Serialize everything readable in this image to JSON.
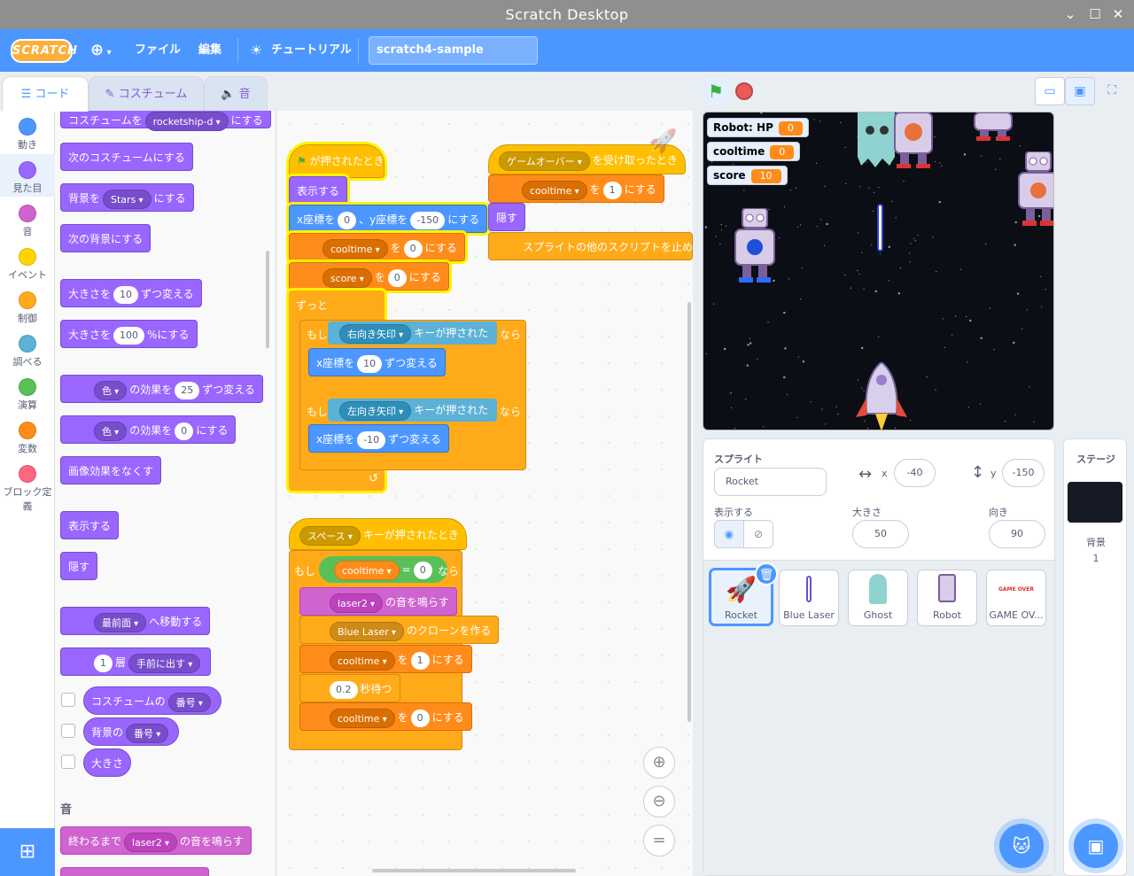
{
  "window": {
    "title": "Scratch Desktop"
  },
  "menu": {
    "logo": "SCRATCH",
    "file": "ファイル",
    "edit": "編集",
    "tutorial": "チュートリアル",
    "project_title": "scratch4-sample"
  },
  "tabs": {
    "code": "コード",
    "costume": "コスチューム",
    "sound": "音"
  },
  "categories": [
    {
      "label": "動き",
      "color": "#4c97ff"
    },
    {
      "label": "見た目",
      "color": "#9966ff"
    },
    {
      "label": "音",
      "color": "#cf63cf"
    },
    {
      "label": "イベント",
      "color": "#ffd500"
    },
    {
      "label": "制御",
      "color": "#ffab19"
    },
    {
      "label": "調べる",
      "color": "#5cb1d6"
    },
    {
      "label": "演算",
      "color": "#59c059"
    },
    {
      "label": "変数",
      "color": "#ff8c1a"
    },
    {
      "label": "ブロック定義",
      "color": "#ff6680"
    }
  ],
  "palette": {
    "costume_to": "コスチュームを",
    "costume_name": "rocketship-d",
    "nisuru": "にする",
    "next_costume": "次のコスチュームにする",
    "backdrop_to": "背景を",
    "backdrop_name": "Stars",
    "next_backdrop": "次の背景にする",
    "size_by_pre": "大きさを",
    "size_by_val": "10",
    "size_by_post": "ずつ変える",
    "size_to_pre": "大きさを",
    "size_to_val": "100",
    "size_to_post": "%にする",
    "effect_dd": "色",
    "effect_change_mid": "の効果を",
    "effect_change_val": "25",
    "effect_change_post": "ずつ変える",
    "effect_set_val": "0",
    "effect_set_post": "にする",
    "clear_effects": "画像効果をなくす",
    "show": "表示する",
    "hide": "隠す",
    "goto_layer": "最前面",
    "goto_layer_post": "へ移動する",
    "layer_val": "1",
    "layer_mid": "層",
    "layer_dd": "手前に出す",
    "costume_rep": "コスチュームの",
    "costume_rep_dd": "番号",
    "backdrop_rep": "背景の",
    "backdrop_rep_dd": "番号",
    "size_rep": "大きさ",
    "sound_heading": "音",
    "play_until_pre": "終わるまで",
    "play_until_dd": "laser2",
    "play_until_post": "の音を鳴らす"
  },
  "script1": {
    "flag_clicked": "が押されたとき",
    "show": "表示する",
    "goto_x": "x座標を",
    "goto_xv": "0",
    "goto_y": "、y座標を",
    "goto_yv": "-150",
    "goto_post": "にする",
    "set_cool_dd": "cooltime",
    "wo": "を",
    "set_cool_v": "0",
    "nisuru": "にする",
    "set_score_dd": "score",
    "set_score_v": "0",
    "forever": "ずっと",
    "if": "もし",
    "then": "なら",
    "key_right": "右向き矢印",
    "key_pressed": "キーが押された",
    "change_x": "x座標を",
    "change_x_v1": "10",
    "change_x_post": "ずつ変える",
    "key_left": "左向き矢印",
    "change_x_v2": "-10",
    "loop_arrow": "↺"
  },
  "script2": {
    "gameover_dd": "ゲームオーバー",
    "receive_post": "を受け取ったとき",
    "set_dd": "cooltime",
    "wo": "を",
    "set_v": "1",
    "nisuru": "にする",
    "hide": "隠す",
    "stop": "スプライトの他のスクリプトを止める"
  },
  "script3": {
    "key_dd": "スペース",
    "key_post": "キーが押されたとき",
    "if": "もし",
    "then": "なら",
    "cmp_var": "cooltime",
    "cmp_op": "=",
    "cmp_val": "0",
    "sound_dd": "laser2",
    "sound_post": "の音を鳴らす",
    "clone_dd": "Blue Laser",
    "clone_post": "のクローンを作る",
    "set1_dd": "cooltime",
    "wo": "を",
    "set1_v": "1",
    "nisuru": "にする",
    "wait_v": "0.2",
    "wait_post": "秒待つ",
    "set2_dd": "cooltime",
    "set2_v": "0"
  },
  "zoom": {
    "in": "⊕",
    "out": "⊖",
    "reset": "="
  },
  "monitors": [
    {
      "name": "Robot: HP",
      "value": "0"
    },
    {
      "name": "cooltime",
      "value": "0"
    },
    {
      "name": "score",
      "value": "10"
    }
  ],
  "sprite_info": {
    "heading": "スプライト",
    "name": "Rocket",
    "x_label": "x",
    "x": "-40",
    "y_label": "y",
    "y": "-150",
    "show_label": "表示する",
    "size_label": "大きさ",
    "size": "50",
    "direction_label": "向き",
    "direction": "90"
  },
  "sprites": [
    {
      "name": "Rocket",
      "selected": true
    },
    {
      "name": "Blue Laser",
      "selected": false
    },
    {
      "name": "Ghost",
      "selected": false
    },
    {
      "name": "Robot",
      "selected": false
    },
    {
      "name": "GAME OV...",
      "selected": false
    }
  ],
  "gameover_thumb": "GAME OVER",
  "stage_pane": {
    "heading": "ステージ",
    "backdrop_label": "背景",
    "backdrop_count": "1"
  }
}
